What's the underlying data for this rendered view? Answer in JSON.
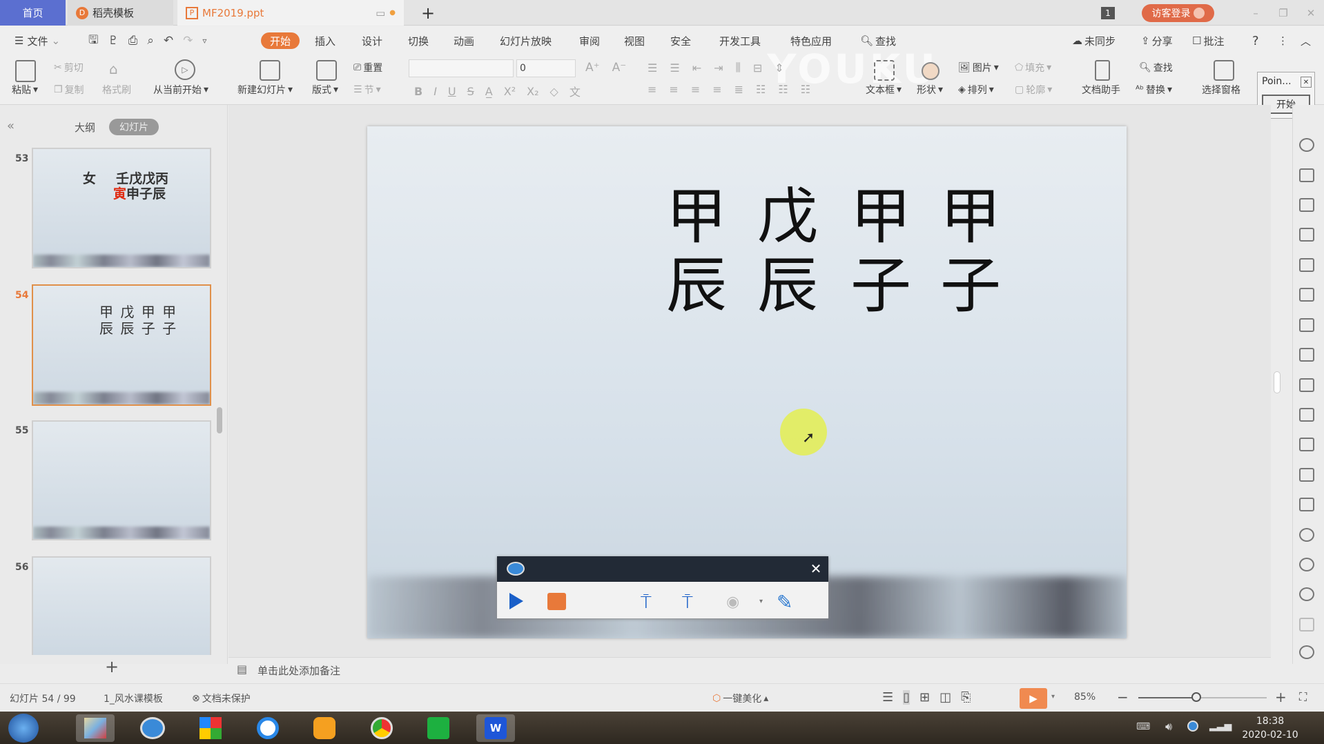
{
  "tabs": [
    {
      "label": "首页",
      "active": false
    },
    {
      "label": "稻壳模板"
    },
    {
      "label": "MF2019.ppt",
      "active": true
    }
  ],
  "title_right": {
    "window_count": "1",
    "login": "访客登录"
  },
  "menu": {
    "file": "文件",
    "items": [
      "开始",
      "插入",
      "设计",
      "切换",
      "动画",
      "幻灯片放映",
      "审阅",
      "视图",
      "安全",
      "开发工具",
      "特色应用"
    ],
    "active": "开始",
    "search": "查找",
    "sync": "未同步",
    "share": "分享",
    "comment": "批注",
    "help": "?"
  },
  "ribbon": {
    "paste": "粘贴",
    "cut": "剪切",
    "copy": "复制",
    "format_painter": "格式刷",
    "play_from_current": "从当前开始",
    "new_slide": "新建幻灯片",
    "layout": "版式",
    "reset": "重置",
    "section": "节",
    "font_name": "",
    "font_size": "0",
    "textbox": "文本框",
    "shape": "形状",
    "picture": "图片",
    "arrange": "排列",
    "fill": "填充",
    "outline": "轮廓",
    "doc_assistant": "文档助手",
    "find": "查找",
    "replace": "替换",
    "select_pane": "选择窗格",
    "watermark": "YOUKU"
  },
  "pointer_panel": {
    "title": "Poin...",
    "start": "开始"
  },
  "left_panel": {
    "outline_tab": "大纲",
    "slides_tab": "幻灯片",
    "add": "+"
  },
  "thumbnails": [
    {
      "num": "53",
      "line1_left": "女",
      "line1": "壬戊戊丙",
      "line2_red": "寅",
      "line2": "申子辰"
    },
    {
      "num": "54",
      "line1": "甲 戊 甲 甲",
      "line2": "辰 辰 子 子",
      "selected": true
    },
    {
      "num": "55"
    },
    {
      "num": "56"
    }
  ],
  "slide": {
    "row1": [
      "甲",
      "戊",
      "甲",
      "甲"
    ],
    "row2": [
      "辰",
      "辰",
      "子",
      "子"
    ]
  },
  "recorder": {
    "accent_play": "#1a5fc8",
    "accent_stop": "#e8793a"
  },
  "notes": {
    "placeholder": "单击此处添加备注"
  },
  "status": {
    "slide_pos": "幻灯片 54 / 99",
    "template": "1_风水课模板",
    "protect": "文档未保护",
    "beautify": "一键美化",
    "zoom": "85%",
    "zoom_level": 0.45
  },
  "taskbar": {
    "time": "18:38",
    "date": "2020-02-10"
  },
  "colors": {
    "accent": "#e8793a",
    "home_tab": "#5b6fd0"
  }
}
